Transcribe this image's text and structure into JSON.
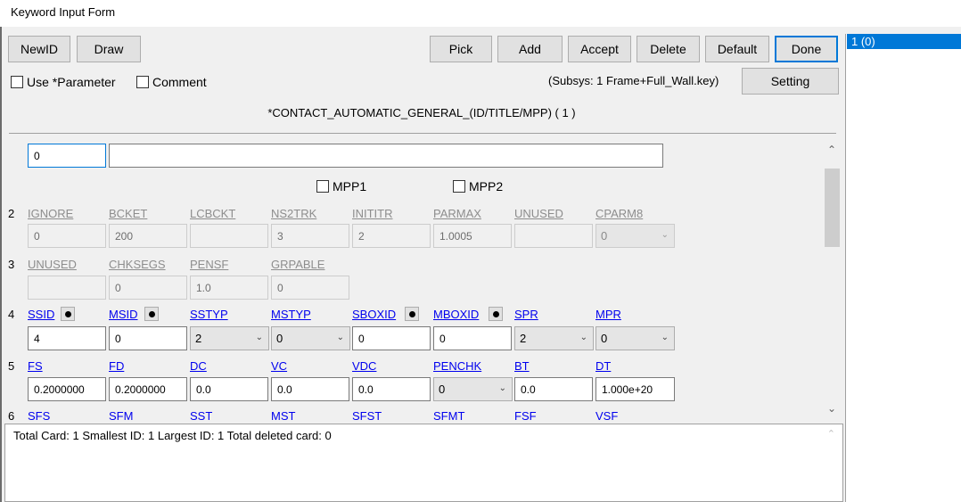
{
  "window": {
    "title": "Keyword Input Form"
  },
  "toolbar": {
    "newid": "NewID",
    "draw": "Draw",
    "pick": "Pick",
    "add": "Add",
    "accept": "Accept",
    "delete": "Delete",
    "default": "Default",
    "done": "Done",
    "setting": "Setting"
  },
  "options": {
    "use_parameter": "Use *Parameter",
    "comment": "Comment"
  },
  "subsys": "(Subsys: 1 Frame+Full_Wall.key)",
  "keyword_heading": "*CONTACT_AUTOMATIC_GENERAL_(ID/TITLE/MPP)   ( 1 )",
  "card1": {
    "id_value": "0",
    "title_value": ""
  },
  "mpp": {
    "mpp1": "MPP1",
    "mpp2": "MPP2"
  },
  "rows": [
    {
      "num": "2",
      "labels": [
        "IGNORE",
        "BCKET",
        "LCBCKT",
        "NS2TRK",
        "INITITR",
        "PARMAX",
        "UNUSED",
        "CPARM8"
      ],
      "values": [
        "0",
        "200",
        "",
        "3",
        "2",
        "1.0005",
        "",
        "0"
      ]
    },
    {
      "num": "3",
      "labels": [
        "UNUSED",
        "CHKSEGS",
        "PENSF",
        "GRPABLE"
      ],
      "values": [
        "",
        "0",
        "1.0",
        "0"
      ]
    },
    {
      "num": "4",
      "labels": [
        "SSID",
        "MSID",
        "SSTYP",
        "MSTYP",
        "SBOXID",
        "MBOXID",
        "SPR",
        "MPR"
      ],
      "values": [
        "4",
        "0",
        "2",
        "0",
        "0",
        "0",
        "2",
        "0"
      ]
    },
    {
      "num": "5",
      "labels": [
        "FS",
        "FD",
        "DC",
        "VC",
        "VDC",
        "PENCHK",
        "BT",
        "DT"
      ],
      "values": [
        "0.2000000",
        "0.2000000",
        "0.0",
        "0.0",
        "0.0",
        "0",
        "0.0",
        "1.000e+20"
      ]
    },
    {
      "num": "6",
      "labels": [
        "SFS",
        "SFM",
        "SST",
        "MST",
        "SFST",
        "SFMT",
        "FSF",
        "VSF"
      ]
    }
  ],
  "log": {
    "text": "Total Card: 1   Smallest ID: 1   Largest ID: 1   Total deleted card:  0"
  },
  "list": {
    "selected_item": "1  (0)"
  },
  "colors": {
    "selection": "#0078d7",
    "link": "#0000ee",
    "disabled_label": "#8d8d8d"
  }
}
